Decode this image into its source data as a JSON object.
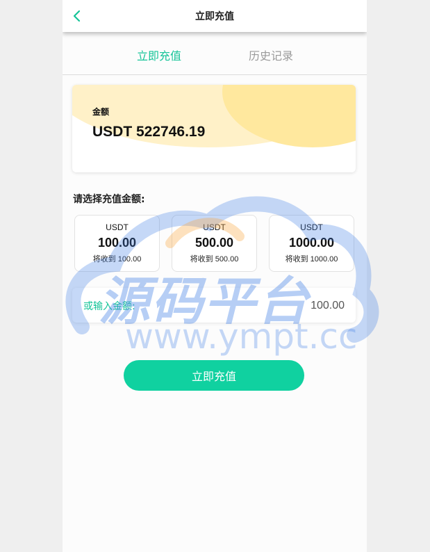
{
  "header": {
    "title": "立即充值"
  },
  "tabs": [
    {
      "label": "立即充值"
    },
    {
      "label": "历史记录"
    }
  ],
  "balance": {
    "label": "金额",
    "value": "USDT 522746.19"
  },
  "select_title": "请选择充值金额:",
  "options": [
    {
      "currency": "USDT",
      "amount": "100.00",
      "receive": "将收到 100.00"
    },
    {
      "currency": "USDT",
      "amount": "500.00",
      "receive": "将收到 500.00"
    },
    {
      "currency": "USDT",
      "amount": "1000.00",
      "receive": "将收到 1000.00"
    }
  ],
  "custom": {
    "label": "或输入金额:",
    "value": "100.00"
  },
  "submit_label": "立即充值",
  "watermark": {
    "main": "源码平台",
    "sub": "www.ympt.cc"
  },
  "colors": {
    "accent": "#15c498",
    "button": "#10d1a0",
    "card_yellow": "#ffe89e"
  },
  "icons": {
    "back": "chevron-left-icon"
  }
}
